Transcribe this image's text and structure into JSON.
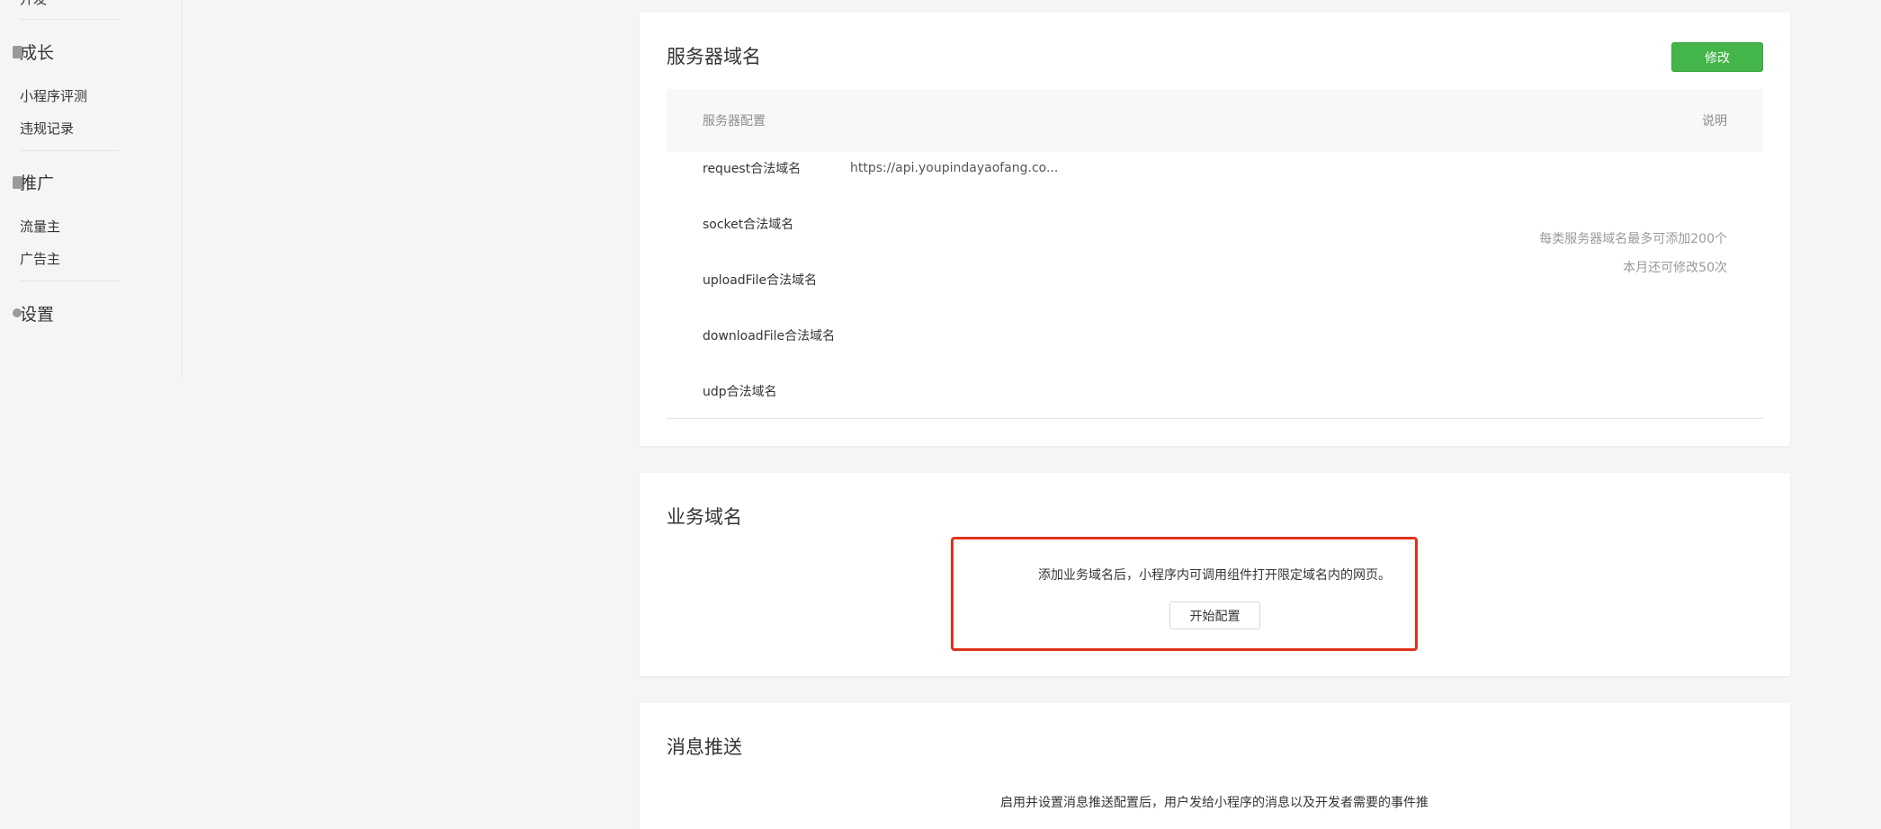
{
  "sidebar": {
    "top_cut_label": "开发",
    "groups": [
      {
        "label": "成长",
        "items": [
          "小程序评测",
          "违规记录"
        ]
      },
      {
        "label": "推广",
        "items": [
          "流量主",
          "广告主"
        ]
      },
      {
        "label": "设置",
        "items": []
      }
    ]
  },
  "server_domain": {
    "title": "服务器域名",
    "edit_button": "修改",
    "table_header": {
      "left": "服务器配置",
      "right": "说明"
    },
    "rows": [
      {
        "label": "request合法域名",
        "value": "https://api.youpindayaofang.co..."
      },
      {
        "label": "socket合法域名",
        "value": ""
      },
      {
        "label": "uploadFile合法域名",
        "value": ""
      },
      {
        "label": "downloadFile合法域名",
        "value": ""
      },
      {
        "label": "udp合法域名",
        "value": ""
      }
    ],
    "notes": [
      "每类服务器域名最多可添加200个",
      "本月还可修改50次"
    ]
  },
  "business_domain": {
    "title": "业务域名",
    "description": "添加业务域名后，小程序内可调用组件打开限定域名内的网页。",
    "start_button": "开始配置"
  },
  "message_push": {
    "title": "消息推送",
    "description_cut": "启用并设置消息推送配置后，用户发给小程序的消息以及开发者需要的事件推"
  },
  "colors": {
    "primary": "#44b549",
    "highlight": "#e0321c",
    "background": "#f5f5f5"
  }
}
